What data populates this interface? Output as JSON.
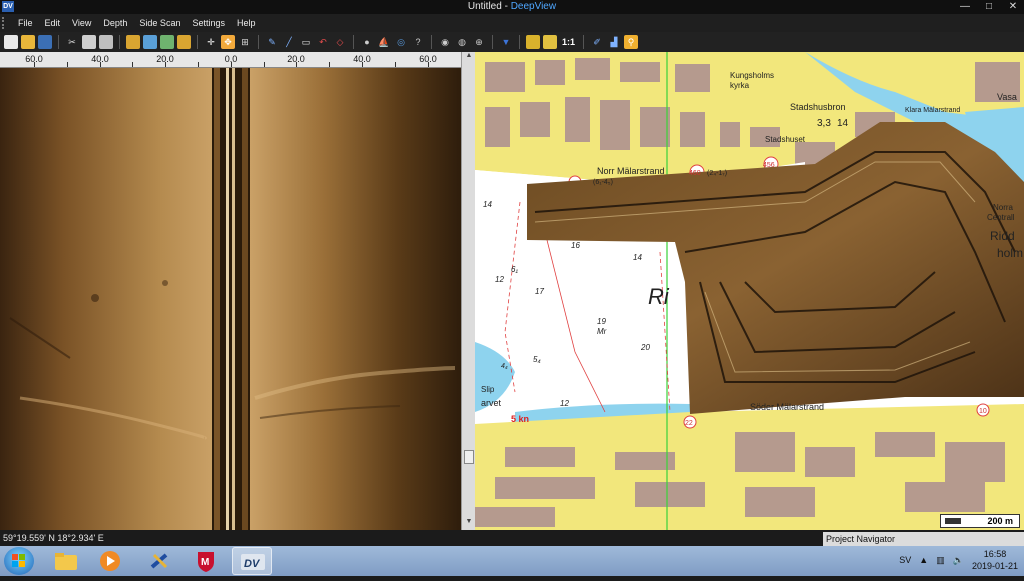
{
  "window": {
    "title_prefix": "Untitled - ",
    "title_app": "DeepView",
    "logo_text": "DV"
  },
  "menu": [
    "File",
    "Edit",
    "View",
    "Depth",
    "Side Scan",
    "Settings",
    "Help"
  ],
  "toolbar": {
    "zoom_label": "1:1"
  },
  "sonar_ruler": {
    "ticks": [
      "60.0",
      "40.0",
      "20.0",
      "0.0",
      "20.0",
      "40.0",
      "60.0"
    ]
  },
  "map": {
    "labels": {
      "kungsholms": "Kungsholms",
      "kyrka": "kyrka",
      "stadshusbron": "Stadshusbron",
      "klara": "Klara Mälarstrand",
      "vasa": "Vasa",
      "stadshuset": "Stadshuset",
      "depth_33": "3,3",
      "depth_14_box": "14",
      "norr": "Norr Mälarstrand",
      "norr_sub": "(6₁-4₅)",
      "road_460": "460",
      "road_460_sub": "(2₄-1₇)",
      "road_456": "456",
      "norra": "Norra",
      "centrall": "Centrall",
      "ridd": "Ridd",
      "holm": "holm",
      "d14a": "14",
      "d16": "16",
      "d14b": "14",
      "d6": "6₁",
      "d12": "12",
      "d17": "17",
      "d19": "19",
      "mr": "Mr",
      "d20": "20",
      "ri": "Ri",
      "d54": "5₄",
      "d12b": "12",
      "slip": "Slip",
      "varvet": "arvet",
      "speed": "5 kn",
      "soder": "Söder Mälarstrand",
      "road_22": "22",
      "road_10": "10",
      "d4": "4₄"
    },
    "scale": "200 m"
  },
  "status": {
    "coords": "59°19.559' N 18°2.934' E",
    "navigator": "Project Navigator"
  },
  "tray": {
    "language": "SV",
    "time": "16:58",
    "date": "2019-01-21"
  }
}
